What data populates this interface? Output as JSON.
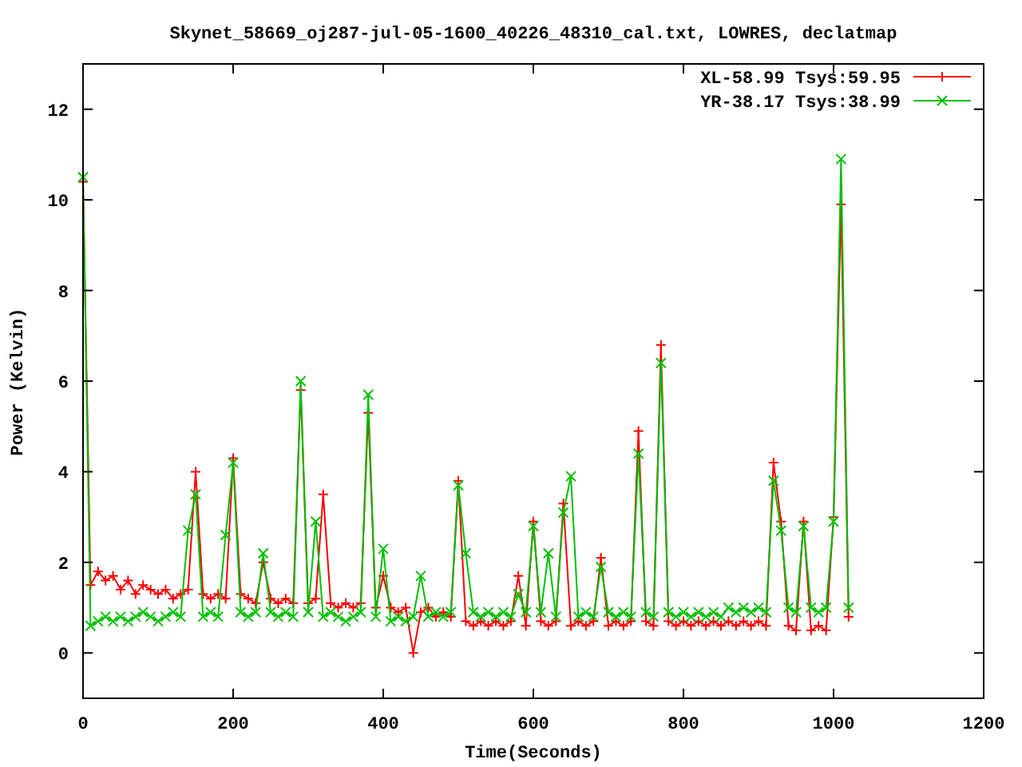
{
  "chart_data": {
    "type": "line",
    "title": "Skynet_58669_oj287-jul-05-1600_40226_48310_cal.txt, LOWRES, declatmap",
    "xlabel": "Time(Seconds)",
    "ylabel": "Power (Kelvin)",
    "x": [
      0,
      10,
      20,
      30,
      40,
      50,
      60,
      70,
      80,
      90,
      100,
      110,
      120,
      130,
      140,
      150,
      160,
      170,
      180,
      190,
      200,
      210,
      220,
      230,
      240,
      250,
      260,
      270,
      280,
      290,
      300,
      310,
      320,
      330,
      340,
      350,
      360,
      370,
      380,
      390,
      400,
      410,
      420,
      430,
      440,
      450,
      460,
      470,
      480,
      490,
      500,
      510,
      520,
      530,
      540,
      550,
      560,
      570,
      580,
      590,
      600,
      610,
      620,
      630,
      640,
      650,
      660,
      670,
      680,
      690,
      700,
      710,
      720,
      730,
      740,
      750,
      760,
      770,
      780,
      790,
      800,
      810,
      820,
      830,
      840,
      850,
      860,
      870,
      880,
      890,
      900,
      910,
      920,
      930,
      940,
      950,
      960,
      970,
      980,
      990,
      1000,
      1010,
      1020
    ],
    "series": [
      {
        "name": "XL-58.99 Tsys:59.95",
        "color": "#ff0000",
        "marker": "plus",
        "values": [
          10.4,
          1.5,
          1.8,
          1.6,
          1.7,
          1.4,
          1.6,
          1.3,
          1.5,
          1.4,
          1.3,
          1.4,
          1.2,
          1.3,
          1.4,
          4.0,
          1.3,
          1.2,
          1.3,
          1.2,
          4.3,
          1.3,
          1.2,
          1.1,
          2.0,
          1.2,
          1.1,
          1.2,
          1.1,
          5.8,
          1.1,
          1.2,
          3.5,
          1.1,
          1.0,
          1.1,
          1.0,
          1.1,
          5.3,
          1.0,
          1.7,
          1.0,
          0.9,
          1.0,
          0.0,
          0.9,
          1.0,
          0.8,
          0.9,
          0.8,
          3.8,
          0.7,
          0.6,
          0.7,
          0.6,
          0.7,
          0.6,
          0.7,
          1.7,
          0.6,
          2.9,
          0.7,
          0.6,
          0.7,
          3.3,
          0.6,
          0.7,
          0.6,
          0.7,
          2.1,
          0.6,
          0.7,
          0.6,
          0.7,
          4.9,
          0.7,
          0.6,
          6.8,
          0.7,
          0.6,
          0.7,
          0.6,
          0.7,
          0.6,
          0.7,
          0.6,
          0.7,
          0.6,
          0.7,
          0.6,
          0.7,
          0.6,
          4.2,
          2.9,
          0.6,
          0.5,
          2.9,
          0.5,
          0.6,
          0.5,
          3.0,
          9.9,
          0.8
        ]
      },
      {
        "name": "YR-38.17 Tsys:38.99",
        "color": "#00c000",
        "marker": "cross",
        "values": [
          10.5,
          0.6,
          0.7,
          0.8,
          0.7,
          0.8,
          0.7,
          0.8,
          0.9,
          0.8,
          0.7,
          0.8,
          0.9,
          0.8,
          2.7,
          3.5,
          0.8,
          0.9,
          0.8,
          2.6,
          4.2,
          0.9,
          0.8,
          0.9,
          2.2,
          0.9,
          0.8,
          0.9,
          0.8,
          6.0,
          0.9,
          2.9,
          0.8,
          0.9,
          0.8,
          0.7,
          0.8,
          0.9,
          5.7,
          0.8,
          2.3,
          0.7,
          0.8,
          0.7,
          0.8,
          1.7,
          0.8,
          0.9,
          0.8,
          0.9,
          3.7,
          2.2,
          0.9,
          0.8,
          0.9,
          0.8,
          0.9,
          0.8,
          1.3,
          0.9,
          2.8,
          0.9,
          2.2,
          0.8,
          3.1,
          3.9,
          0.8,
          0.9,
          0.8,
          1.9,
          0.9,
          0.8,
          0.9,
          0.8,
          4.4,
          0.9,
          0.8,
          6.4,
          0.9,
          0.8,
          0.9,
          0.8,
          0.9,
          0.8,
          0.9,
          0.8,
          1.0,
          0.9,
          1.0,
          0.9,
          1.0,
          0.9,
          3.8,
          2.7,
          1.0,
          0.9,
          2.8,
          1.0,
          0.9,
          1.0,
          2.9,
          10.9,
          1.0
        ]
      }
    ],
    "xlim": [
      0,
      1200
    ],
    "ylim": [
      -1,
      13
    ],
    "xticks": [
      0,
      200,
      400,
      600,
      800,
      1000,
      1200
    ],
    "yticks": [
      0,
      2,
      4,
      6,
      8,
      10,
      12
    ],
    "legend": true
  }
}
